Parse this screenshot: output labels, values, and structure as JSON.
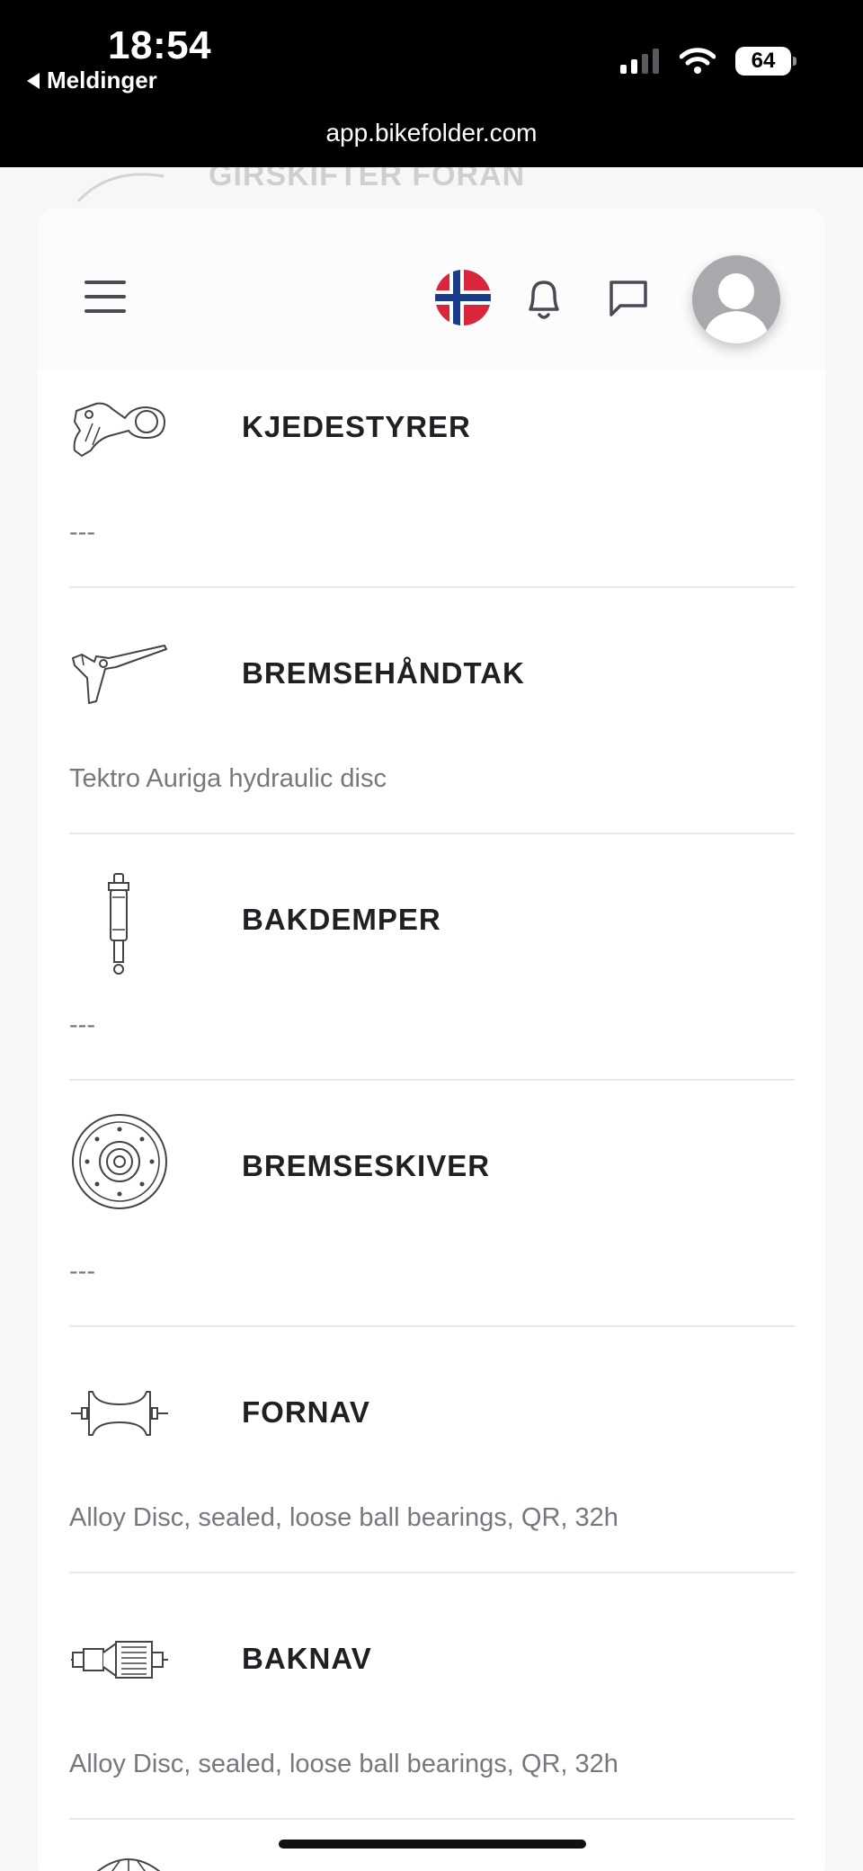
{
  "status_bar": {
    "time": "18:54",
    "back_label": "Meldinger",
    "battery": "64",
    "url": "app.bikefolder.com"
  },
  "ghost_row_title": "GIRSKIFTER FORAN",
  "header": {
    "flag_icon": "norway-flag-icon",
    "bell_icon": "bell-icon",
    "chat_icon": "chat-icon",
    "avatar_icon": "user-avatar-icon"
  },
  "components": [
    {
      "title": "KJEDESTYRER",
      "value": "---",
      "icon": "chain-guide-icon"
    },
    {
      "title": "BREMSEHÅNDTAK",
      "value": "Tektro Auriga hydraulic disc",
      "icon": "brake-lever-icon"
    },
    {
      "title": "BAKDEMPER",
      "value": "---",
      "icon": "rear-shock-icon"
    },
    {
      "title": "BREMSESKIVER",
      "value": "---",
      "icon": "brake-disc-icon"
    },
    {
      "title": "FORNAV",
      "value": "Alloy Disc, sealed, loose ball bearings, QR, 32h",
      "icon": "front-hub-icon"
    },
    {
      "title": "BAKNAV",
      "value": "Alloy Disc, sealed, loose ball bearings, QR, 32h",
      "icon": "rear-hub-icon"
    }
  ],
  "colors": {
    "accent_text": "#1f1f24",
    "muted_text": "#777780",
    "separator": "#e8e8ec"
  }
}
